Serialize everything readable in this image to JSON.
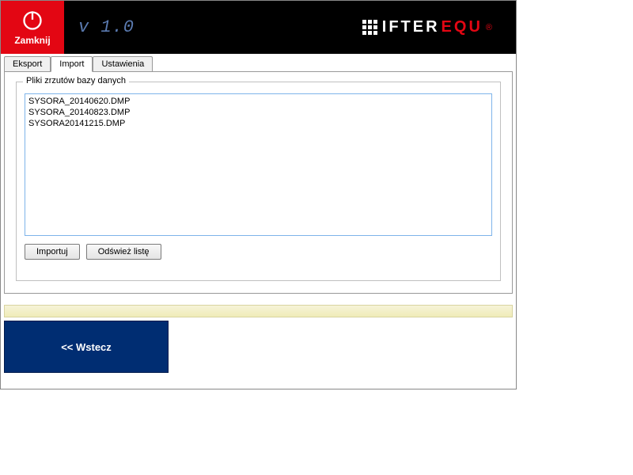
{
  "header": {
    "close_label": "Zamknij",
    "version": "v 1.0",
    "brand_text_1": "IFTER",
    "brand_text_2": "EQU",
    "brand_reg": "®"
  },
  "tabs": [
    {
      "label": "Eksport"
    },
    {
      "label": "Import"
    },
    {
      "label": "Ustawienia"
    }
  ],
  "group_title": "Pliki zrzutów bazy danych",
  "files": [
    "SYSORA_20140620.DMP",
    "SYSORA_20140823.DMP",
    "SYSORA20141215.DMP"
  ],
  "buttons": {
    "import": "Importuj",
    "refresh": "Odśwież listę"
  },
  "back_label": "<< Wstecz"
}
